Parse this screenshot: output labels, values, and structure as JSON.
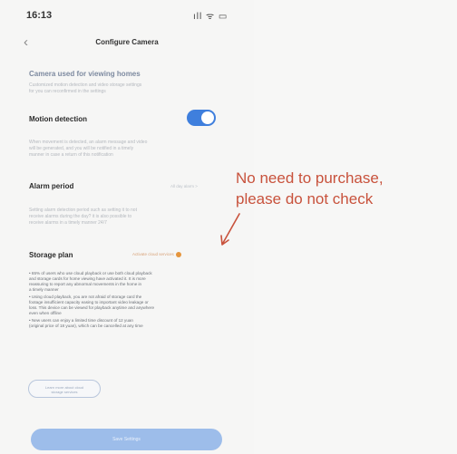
{
  "status_bar": {
    "time": "16:13",
    "icons": "ıll ᯤ ▭"
  },
  "nav": {
    "back_glyph": "‹",
    "title": "Configure Camera"
  },
  "sections": {
    "camera": {
      "title": "Camera used for viewing homes",
      "description": "Customized motion detection and video storage settings\nfor you can reconfirmed in the settings"
    },
    "motion": {
      "title": "Motion detection",
      "toggle_on": true,
      "description": "When movement is detected, an alarm message and video\nwill be generated, and you will be notified in a timely\nmanner in case a return of this notification"
    },
    "alarm": {
      "title": "Alarm period",
      "value": "All day alarm >",
      "description": "Setting alarm detection period such as setting it to not\nreceive alarms during the day? it is also possible to\nreceive alarms in a timely manner 24/7"
    },
    "storage": {
      "title": "Storage plan",
      "value": "Activate cloud services",
      "bullets": [
        "• 65% of users who use cloud playback or use both cloud playback\nand storage cards for home viewing have activated it. It is more\nreassuring to report any abnormal movements in the home in\na timely manner",
        "• Using cloud playback, you are not afraid of storage card the\nfootage insufficient capacity easing to important video leakage or\nloss. This device can be viewed for playback anytime and anywhere\neven when offline",
        "• New users can enjoy a limited time discount of 12 yuan\n(original price of 18 yuan), which can be cancelled at any time"
      ]
    }
  },
  "buttons": {
    "secondary": "Learn more about cloud\nstorage services",
    "primary": "Save Settings"
  },
  "annotation": {
    "text": "No need to purchase,\nplease do not check",
    "color": "#c8523c"
  },
  "colors": {
    "accent": "#3f7fdd",
    "warning": "#e5953d"
  }
}
